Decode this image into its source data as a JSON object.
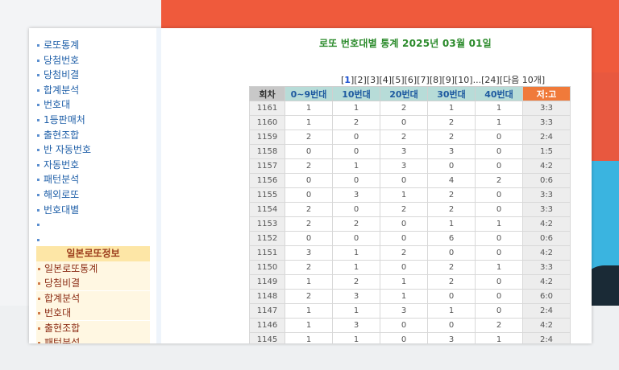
{
  "page_title": "로또 번호대별 통계 2025년 03월 01일",
  "sidebar": {
    "items": [
      "로또통계",
      "당첨번호",
      "당첨비결",
      "합계분석",
      "번호대",
      "1등판매처",
      "출현조합",
      "반 자동번호",
      "자동번호",
      "패턴분석",
      "해외로또",
      "번호대별",
      "",
      ""
    ],
    "section_header": "일본로또정보",
    "jp_items": [
      "일본로또통계",
      "당첨비결",
      "합계분석",
      "번호대",
      "출현조합",
      "패턴분석"
    ]
  },
  "pager": {
    "pages": [
      "1",
      "2",
      "3",
      "4",
      "5",
      "6",
      "7",
      "8",
      "9",
      "10"
    ],
    "ellipsis": "...",
    "last": "24",
    "next": "다음 10개",
    "current": "1"
  },
  "table": {
    "headers": [
      "회차",
      "0~9번대",
      "10번대",
      "20번대",
      "30번대",
      "40번대",
      "저:고"
    ],
    "rows": [
      [
        "1161",
        "1",
        "1",
        "2",
        "1",
        "1",
        "3:3"
      ],
      [
        "1160",
        "1",
        "2",
        "0",
        "2",
        "1",
        "3:3"
      ],
      [
        "1159",
        "2",
        "0",
        "2",
        "2",
        "0",
        "2:4"
      ],
      [
        "1158",
        "0",
        "0",
        "3",
        "3",
        "0",
        "1:5"
      ],
      [
        "1157",
        "2",
        "1",
        "3",
        "0",
        "0",
        "4:2"
      ],
      [
        "1156",
        "0",
        "0",
        "0",
        "4",
        "2",
        "0:6"
      ],
      [
        "1155",
        "0",
        "3",
        "1",
        "2",
        "0",
        "3:3"
      ],
      [
        "1154",
        "2",
        "0",
        "2",
        "2",
        "0",
        "3:3"
      ],
      [
        "1153",
        "2",
        "2",
        "0",
        "1",
        "1",
        "4:2"
      ],
      [
        "1152",
        "0",
        "0",
        "0",
        "6",
        "0",
        "0:6"
      ],
      [
        "1151",
        "3",
        "1",
        "2",
        "0",
        "0",
        "4:2"
      ],
      [
        "1150",
        "2",
        "1",
        "0",
        "2",
        "1",
        "3:3"
      ],
      [
        "1149",
        "1",
        "2",
        "1",
        "2",
        "0",
        "4:2"
      ],
      [
        "1148",
        "2",
        "3",
        "1",
        "0",
        "0",
        "6:0"
      ],
      [
        "1147",
        "1",
        "1",
        "3",
        "1",
        "0",
        "2:4"
      ],
      [
        "1146",
        "1",
        "3",
        "0",
        "0",
        "2",
        "4:2"
      ],
      [
        "1145",
        "1",
        "1",
        "0",
        "3",
        "1",
        "2:4"
      ]
    ]
  },
  "colors": {
    "title": "#2a8a2a",
    "link": "#1f5fa8",
    "header_range": "#b7dcd8",
    "header_ratio": "#f07a3a"
  }
}
